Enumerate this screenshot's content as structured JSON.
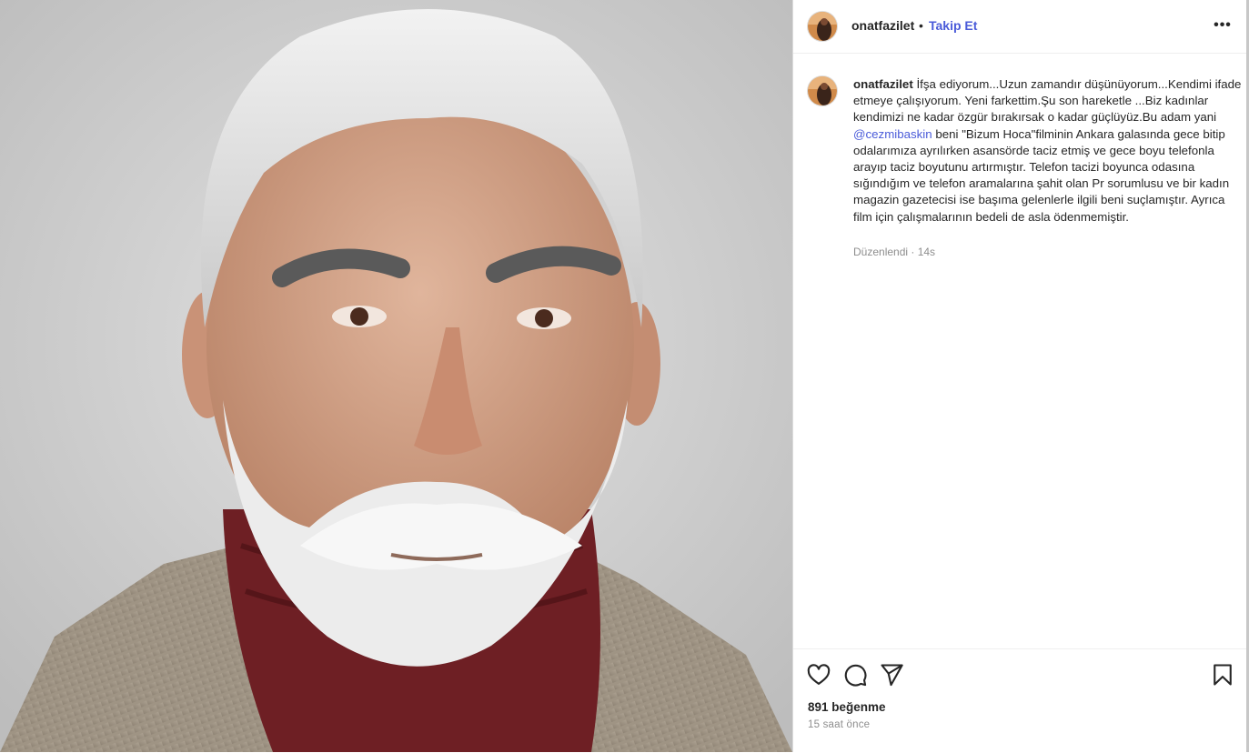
{
  "post": {
    "media_alt": "Portrait of an older man with white hair and beard wearing a burgundy turtleneck and corduroy jacket"
  },
  "header": {
    "username": "onatfazilet",
    "separator": "•",
    "follow_label": "Takip Et",
    "more_icon": "more-horizontal-icon",
    "more_glyph": "•••"
  },
  "caption": {
    "username": "onatfazilet",
    "text_part1": "İfşa ediyorum...Uzun zamandır düşünüyorum...Kendimi ifade etmeye çalışıyorum. Yeni farkettim.Şu son hareketle ...Biz kadınlar kendimizi ne kadar özgür bırakırsak o kadar güçlüyüz.Bu adam yani ",
    "mention": "@cezmibaskin",
    "text_part2": " beni \"Bizum Hoca\"filminin Ankara galasında gece bitip odalarımıza ayrılırken asansörde taciz etmiş ve gece boyu telefonla arayıp taciz boyutunu artırmıştır. Telefon tacizi boyunca odasına sığındığım ve telefon aramalarına şahit olan Pr sorumlusu ve bir kadın magazin gazetecisi ise başıma gelenlerle ilgili beni suçlamıştır. Ayrıca film için çalışmalarının bedeli de asla ödenmemiştir.",
    "edited": "Düzenlendi · 14s"
  },
  "actions": {
    "like_icon": "heart-icon",
    "comment_icon": "comment-icon",
    "share_icon": "send-icon",
    "save_icon": "bookmark-icon",
    "likes": "891 beğenme",
    "time_ago": "15 saat önce"
  },
  "colors": {
    "link": "#4a5bd9",
    "text": "#262626",
    "muted": "#8e8e8e",
    "border": "#dbdbdb"
  }
}
